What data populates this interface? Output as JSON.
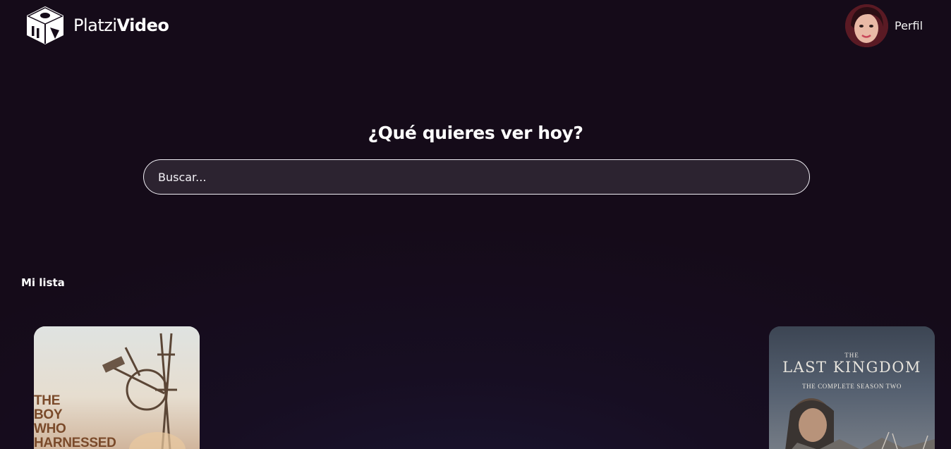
{
  "header": {
    "logo": {
      "icon": "platzi-video-cube-icon",
      "name_light": "Platzi",
      "name_bold": "Video"
    },
    "profile": {
      "label": "Perfil",
      "avatar": "user-avatar"
    }
  },
  "hero": {
    "title": "¿Qué quieres ver hoy?",
    "search_placeholder": "Buscar..."
  },
  "sections": {
    "my_list": {
      "title": "Mi lista",
      "items": [
        {
          "poster_text": "THE\nBOY\nWHO\nHARNESSED"
        },
        {
          "poster_the": "THE",
          "poster_title": "LAST KINGDOM",
          "poster_subtitle": "THE COMPLETE SEASON TWO"
        }
      ]
    }
  },
  "colors": {
    "background": "#150b19",
    "text": "#ffffff",
    "search_border": "#f0eef4"
  }
}
